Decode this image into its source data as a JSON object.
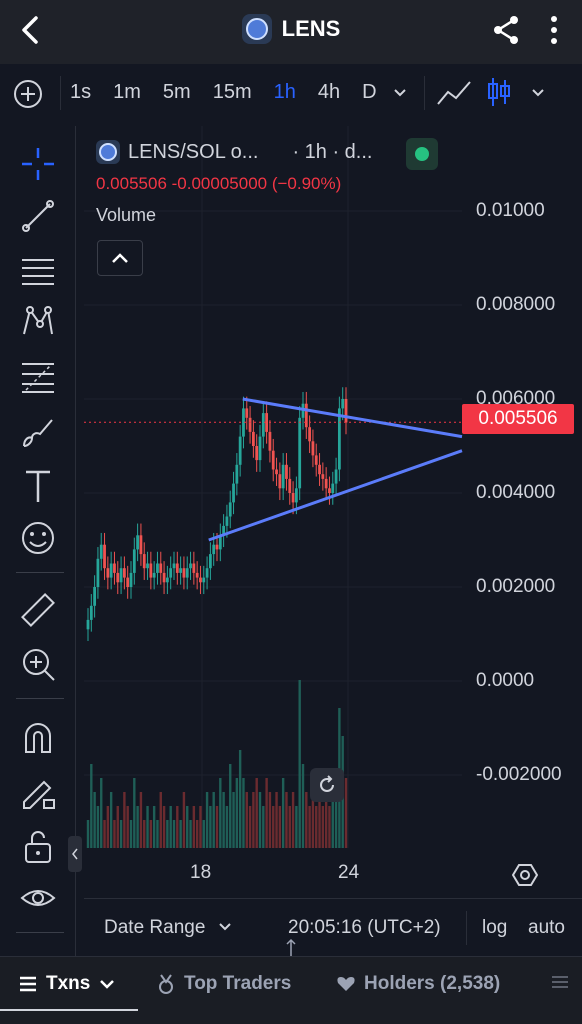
{
  "header": {
    "title": "LENS"
  },
  "toolbar": {
    "intervals": [
      "1s",
      "1m",
      "5m",
      "15m",
      "1h",
      "4h",
      "D"
    ],
    "active_interval": "1h"
  },
  "legend": {
    "symbol": "LENS/SOL o...",
    "interval": "· 1h · d...",
    "price_line": "0.005506 -0.00005000 (−0.90%)",
    "volume_label": "Volume"
  },
  "y_axis": {
    "labels": [
      "0.01000",
      "0.008000",
      "0.006000",
      "0.004000",
      "0.002000",
      "0.0000",
      "-0.002000"
    ],
    "current_price": "0.005506"
  },
  "x_axis": {
    "labels": [
      "18",
      "24"
    ]
  },
  "bottom_bar": {
    "date_range": "Date Range",
    "clock": "20:05:16 (UTC+2)",
    "log": "log",
    "auto": "auto"
  },
  "tabs": {
    "txns": "Txns",
    "top_traders": "Top Traders",
    "holders": "Holders (2,538)"
  },
  "colors": {
    "up": "#26a69a",
    "down": "#ef5350",
    "trendline": "#5b7cfa",
    "accent": "#2962ff",
    "price_tag": "#f23645"
  },
  "chart_data": {
    "type": "candlestick",
    "title": "",
    "xlabel": "",
    "ylabel": "",
    "ylim": [
      -0.0025,
      0.0115
    ],
    "x_ticks": [
      "18",
      "24"
    ],
    "last_price": 0.005506,
    "close_series": [
      0.0013,
      0.0016,
      0.002,
      0.0026,
      0.0029,
      0.0024,
      0.0022,
      0.0025,
      0.0023,
      0.0021,
      0.0024,
      0.0022,
      0.002,
      0.0023,
      0.0028,
      0.0031,
      0.0027,
      0.0024,
      0.0025,
      0.0022,
      0.0023,
      0.0025,
      0.0023,
      0.0021,
      0.0022,
      0.0024,
      0.0025,
      0.0023,
      0.0024,
      0.0022,
      0.0024,
      0.0025,
      0.0023,
      0.0022,
      0.0021,
      0.0022,
      0.0024,
      0.0027,
      0.0029,
      0.0028,
      0.0031,
      0.0033,
      0.0035,
      0.0038,
      0.0042,
      0.0046,
      0.0052,
      0.0058,
      0.0056,
      0.0053,
      0.005,
      0.0047,
      0.0052,
      0.0057,
      0.0053,
      0.0049,
      0.0045,
      0.0044,
      0.0041,
      0.0046,
      0.0043,
      0.004,
      0.0038,
      0.0041,
      0.0056,
      0.0059,
      0.0054,
      0.0051,
      0.0048,
      0.0046,
      0.0044,
      0.0043,
      0.0041,
      0.004,
      0.0042,
      0.0045,
      0.0058,
      0.006,
      0.0055
    ],
    "volume_series": [
      2,
      6,
      4,
      3,
      5,
      2,
      3,
      4,
      2,
      3,
      2,
      4,
      3,
      2,
      5,
      3,
      4,
      2,
      3,
      2,
      3,
      2,
      4,
      3,
      2,
      3,
      2,
      3,
      2,
      4,
      3,
      2,
      3,
      2,
      3,
      2,
      4,
      3,
      4,
      3,
      5,
      4,
      3,
      6,
      4,
      5,
      7,
      5,
      4,
      3,
      4,
      5,
      4,
      3,
      5,
      4,
      3,
      4,
      3,
      5,
      4,
      3,
      4,
      3,
      12,
      6,
      4,
      3,
      4,
      3,
      4,
      3,
      4,
      3,
      5,
      4,
      10,
      8,
      5
    ],
    "trendlines": [
      {
        "from": [
          0.42,
          0.006
        ],
        "to": [
          1.0,
          0.0052
        ]
      },
      {
        "from": [
          0.33,
          0.003
        ],
        "to": [
          1.0,
          0.0049
        ]
      }
    ]
  }
}
